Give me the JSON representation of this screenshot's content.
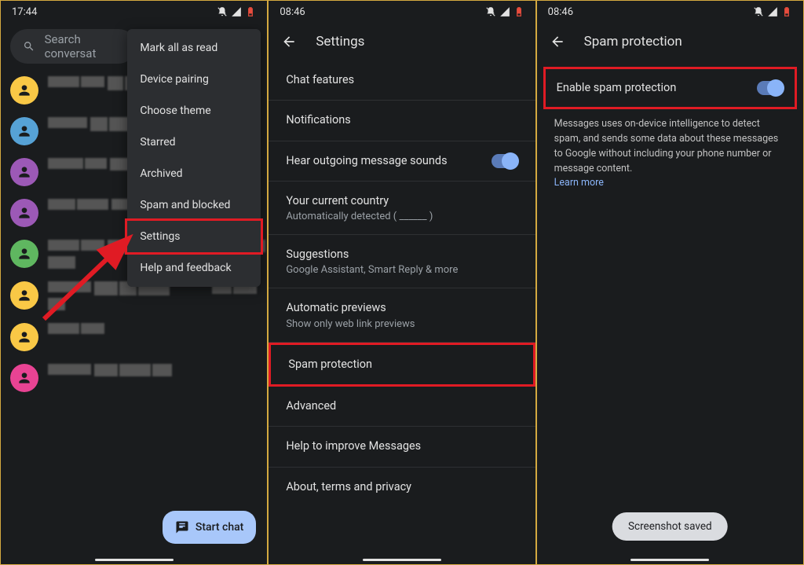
{
  "screen1": {
    "time": "17:44",
    "search_placeholder": "Search conversat",
    "menu": {
      "mark_all": "Mark all as read",
      "pairing": "Device pairing",
      "theme": "Choose theme",
      "starred": "Starred",
      "archived": "Archived",
      "spam": "Spam and blocked",
      "settings": "Settings",
      "help": "Help and feedback"
    },
    "avatar_colors": [
      "#f9c846",
      "#56a2d6",
      "#9c59b6",
      "#9c59b6",
      "#5fb760",
      "#f9c846",
      "#f9c846",
      "#e84393"
    ],
    "fab_label": "Start chat"
  },
  "screen2": {
    "time": "08:46",
    "title": "Settings",
    "rows": {
      "chat": "Chat features",
      "notif": "Notifications",
      "sounds": "Hear outgoing message sounds",
      "country_t": "Your current country",
      "country_s": "Automatically detected ( ______ )",
      "sugg_t": "Suggestions",
      "sugg_s": "Google Assistant, Smart Reply & more",
      "prev_t": "Automatic previews",
      "prev_s": "Show only web link previews",
      "spamp": "Spam protection",
      "adv": "Advanced",
      "help_imp": "Help to improve Messages",
      "about": "About, terms and privacy"
    }
  },
  "screen3": {
    "time": "08:46",
    "title": "Spam protection",
    "enable_label": "Enable spam protection",
    "description": "Messages uses on-device intelligence to detect spam, and sends some data about these messages to Google without including your phone number or message content.",
    "learn_more": "Learn more",
    "toast": "Screenshot saved"
  }
}
